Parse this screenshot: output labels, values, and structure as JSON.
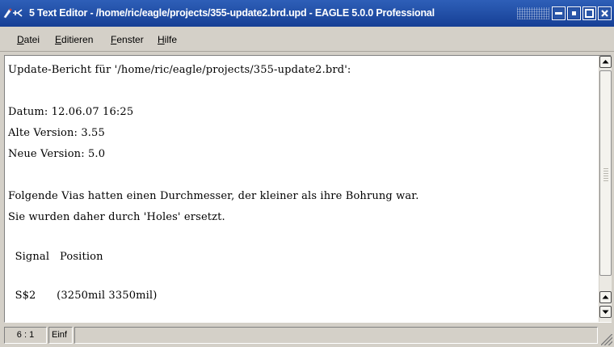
{
  "window": {
    "title": "5 Text Editor - /home/ric/eagle/projects/355-update2.brd.upd - EAGLE 5.0.0 Professional",
    "title_color": "#1f4ea3"
  },
  "menu": {
    "items": [
      {
        "label": "Datei"
      },
      {
        "label": "Editieren"
      },
      {
        "label": "Fenster"
      },
      {
        "label": "Hilfe"
      }
    ]
  },
  "editor": {
    "lines": [
      "Update-Bericht für '/home/ric/eagle/projects/355-update2.brd':",
      "",
      "Datum: 12.06.07 16:25",
      "Alte Version: 3.55",
      "Neue Version: 5.0",
      "",
      "Folgende Vias hatten einen Durchmesser, der kleiner als ihre Bohrung war.",
      "Sie wurden daher durch 'Holes' ersetzt.",
      "",
      "  Signal   Position",
      "",
      "  S$2      (3250mil 3350mil)"
    ]
  },
  "status": {
    "cursor_position": "6 : 1",
    "mode": "Einf",
    "message": ""
  },
  "icons": [
    "app-icon",
    "minimize-icon",
    "maximize-icon",
    "restore-icon",
    "close-icon",
    "scroll-up-arrow-icon",
    "scroll-down-arrow-icon",
    "size-grip-icon"
  ]
}
